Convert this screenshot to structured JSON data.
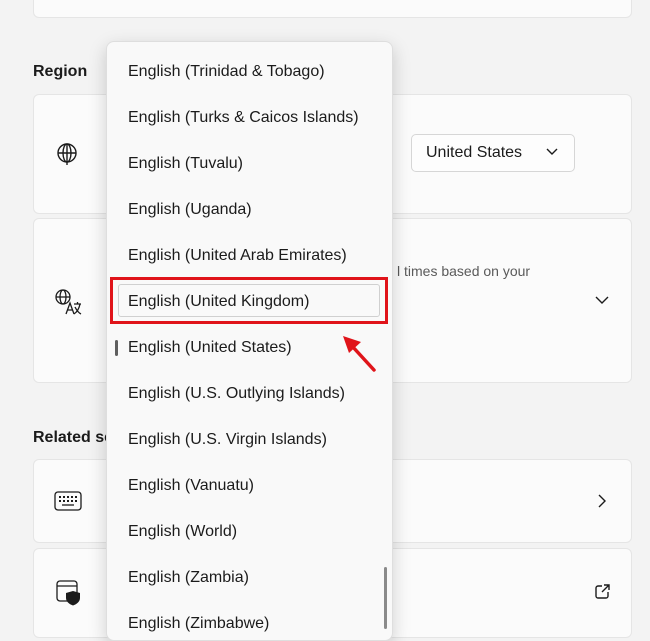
{
  "section_region": {
    "title": "Region"
  },
  "section_related": {
    "title": "Related se"
  },
  "country_setting": {
    "selected_value": "United States"
  },
  "regional_format": {
    "description_fragment": "l times based on your"
  },
  "language_dropdown": {
    "items": [
      "English (Trinidad & Tobago)",
      "English (Turks & Caicos Islands)",
      "English (Tuvalu)",
      "English (Uganda)",
      "English (United Arab Emirates)",
      "English (United Kingdom)",
      "English (United States)",
      "English (U.S. Outlying Islands)",
      "English (U.S. Virgin Islands)",
      "English (Vanuatu)",
      "English (World)",
      "English (Zambia)",
      "English (Zimbabwe)"
    ],
    "selected_index": 6,
    "highlighted_index": 5
  },
  "colors": {
    "highlight": "#e0141a",
    "accent_bar": "#5f5f5f"
  },
  "icons": [
    "globe-icon",
    "language-format-icon",
    "chevron-down-icon",
    "keyboard-icon",
    "chevron-right-icon",
    "security-shield-icon",
    "external-link-icon",
    "red-pointer-arrow-icon"
  ]
}
